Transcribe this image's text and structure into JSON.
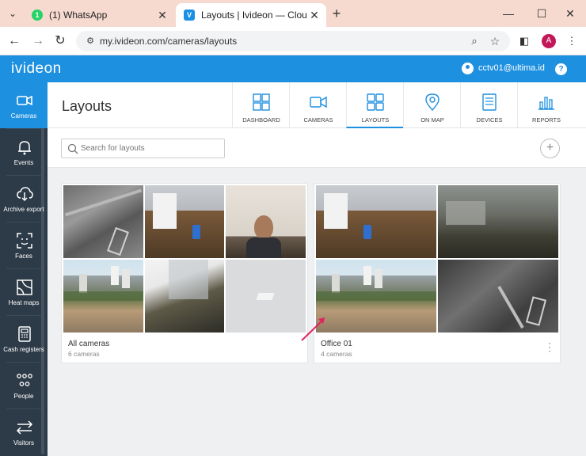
{
  "browser": {
    "tabs": [
      {
        "title": "(1) WhatsApp",
        "favicon": "1",
        "active": false
      },
      {
        "title": "Layouts | Ivideon — Cloud Video",
        "favicon": "V",
        "active": true
      }
    ],
    "new_tab_label": "+",
    "url": "my.ivideon.com/cameras/layouts",
    "profile_initial": "A"
  },
  "app": {
    "brand": "ivideon",
    "user_email": "cctv01@ultima.id",
    "help_label": "?",
    "accent_color": "#1e90e0"
  },
  "sidebar": {
    "items": [
      {
        "label": "Cameras",
        "icon": "camera-icon",
        "active": true
      },
      {
        "label": "Events",
        "icon": "bell-icon"
      },
      {
        "label": "Archive export",
        "icon": "cloud-download-icon"
      },
      {
        "label": "Faces",
        "icon": "face-scan-icon"
      },
      {
        "label": "Heat maps",
        "icon": "heat-map-icon"
      },
      {
        "label": "Cash registers",
        "icon": "cash-register-icon"
      },
      {
        "label": "People",
        "icon": "people-icon"
      },
      {
        "label": "Visitors",
        "icon": "visitors-icon"
      }
    ]
  },
  "page": {
    "title": "Layouts",
    "nav": [
      {
        "label": "DASHBOARD",
        "icon": "dashboard-icon"
      },
      {
        "label": "CAMERAS",
        "icon": "camera-icon"
      },
      {
        "label": "LAYOUTS",
        "icon": "layouts-icon",
        "active": true
      },
      {
        "label": "ON MAP",
        "icon": "map-pin-icon"
      },
      {
        "label": "DEVICES",
        "icon": "devices-icon"
      },
      {
        "label": "REPORTS",
        "icon": "reports-icon"
      }
    ],
    "search_placeholder": "Search for layouts",
    "add_label": "+"
  },
  "layouts": [
    {
      "name": "All cameras",
      "count": "6 cameras"
    },
    {
      "name": "Office 01",
      "count": "4 cameras"
    }
  ]
}
